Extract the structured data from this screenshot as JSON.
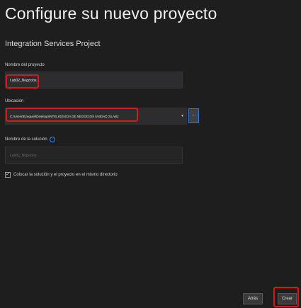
{
  "header": {
    "title": "Configure su nuevo proyecto",
    "project_type": "Integration Services Project"
  },
  "form": {
    "project_name_label": "Nombre del proyecto",
    "project_name_value": "Lab02_Negocios",
    "location_label": "Ubicación",
    "location_value": "C:\\Users\\Ezequiel\\Desktop\\INTELIGENCIA DE NEGOCIOS UNIDAD 2\\LAB2",
    "browse_label": "...",
    "solution_name_label": "Nombre de la solución",
    "solution_name_placeholder": "Lab02_Negocios",
    "same_directory_label": "Colocar la solución y el proyecto en el mismo directorio",
    "same_directory_checked": true
  },
  "footer": {
    "back_label": "Atrás",
    "create_label": "Crear"
  },
  "colors": {
    "background": "#1e1e1e",
    "highlight": "#d21c1c",
    "accent": "#2c7ad6"
  },
  "icons": {
    "dropdown": "chevron-down-icon",
    "info": "info-icon",
    "checkbox": "checkmark-icon"
  }
}
